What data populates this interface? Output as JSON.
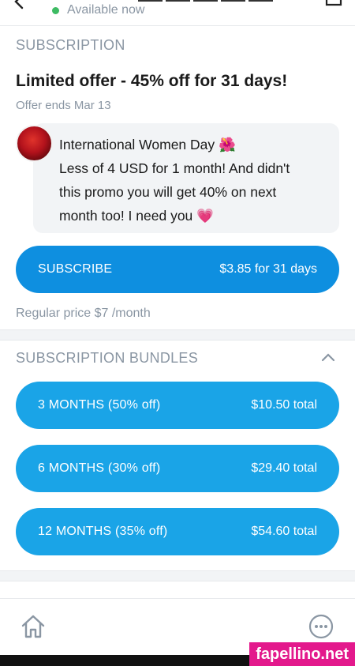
{
  "header": {
    "status": "Available now"
  },
  "subscription": {
    "section_title": "SUBSCRIPTION",
    "offer_title": "Limited offer - 45% off for 31 days!",
    "offer_ends": "Offer ends Mar 13",
    "message_lines": [
      "International Women Day 🌺",
      "Less of 4 USD for 1 month! And didn't",
      "this promo you will get 40% on next",
      "month too! I need you 💗"
    ],
    "subscribe_button": {
      "label": "SUBSCRIBE",
      "price": "$3.85 for 31 days"
    },
    "regular_price": "Regular price $7 /month"
  },
  "bundles": {
    "section_title": "SUBSCRIPTION BUNDLES",
    "items": [
      {
        "label": "3 MONTHS (50% off)",
        "price": "$10.50 total"
      },
      {
        "label": "6 MONTHS (30% off)",
        "price": "$29.40 total"
      },
      {
        "label": "12 MONTHS (35% off)",
        "price": "$54.60 total"
      }
    ]
  },
  "watermark": "fapellino.net",
  "colors": {
    "primary_button": "#0e8fe0",
    "bundle_button": "#1aa4e7",
    "muted_text": "#8a96a3",
    "online_dot": "#3dbb63",
    "watermark_bg": "#e3198c"
  },
  "icons": {
    "back": "arrow-left-icon",
    "share": "share-icon",
    "collapse": "chevron-up-icon",
    "home": "home-icon",
    "more": "more-icon"
  }
}
